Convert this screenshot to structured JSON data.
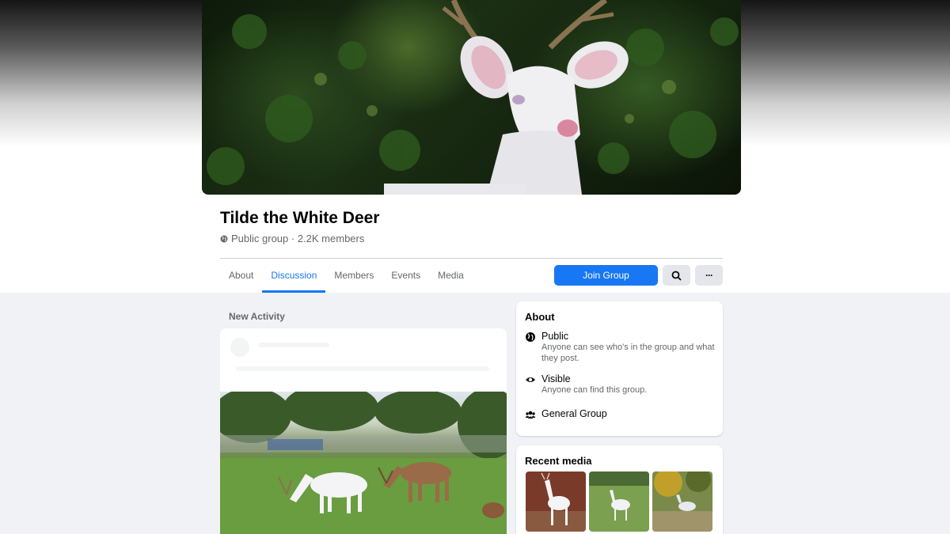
{
  "group": {
    "name": "Tilde the White Deer",
    "meta": "Public group · 2.2K members"
  },
  "tabs": [
    {
      "label": "About"
    },
    {
      "label": "Discussion",
      "active": true
    },
    {
      "label": "Members"
    },
    {
      "label": "Events"
    },
    {
      "label": "Media"
    }
  ],
  "actions": {
    "join_label": "Join Group",
    "search_icon": "search-icon",
    "more_label": "···"
  },
  "feed": {
    "section_label": "New Activity"
  },
  "about": {
    "title": "About",
    "items": [
      {
        "icon": "globe-icon",
        "label": "Public",
        "description": "Anyone can see who's in the group and what they post."
      },
      {
        "icon": "eye-icon",
        "label": "Visible",
        "description": "Anyone can find this group."
      },
      {
        "icon": "people-icon",
        "label": "General Group",
        "description": ""
      }
    ]
  },
  "recent_media": {
    "title": "Recent media"
  },
  "colors": {
    "accent": "#1877f2",
    "background": "#f0f2f5",
    "secondary_text": "#65676b"
  }
}
